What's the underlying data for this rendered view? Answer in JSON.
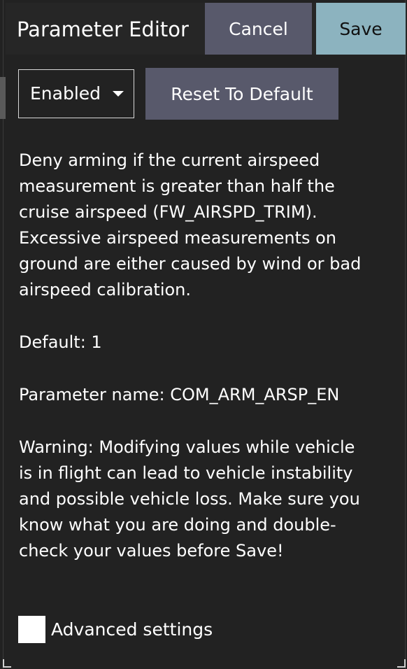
{
  "header": {
    "title": "Parameter Editor",
    "cancel_label": "Cancel",
    "save_label": "Save"
  },
  "controls": {
    "value_selected": "Enabled",
    "reset_label": "Reset To Default"
  },
  "content": {
    "description": "Deny arming if the current airspeed measurement is greater than half the cruise airspeed (FW_AIRSPD_TRIM). Excessive airspeed measurements on ground are either caused by wind or bad airspeed calibration.",
    "default_text": "Default: 1",
    "parameter_name_text": "Parameter name: COM_ARM_ARSP_EN",
    "warning": "Warning: Modifying values while vehicle is in flight can lead to vehicle instability and possible vehicle loss. Make sure you know what you are doing and double-check your values before Save!"
  },
  "advanced": {
    "label": "Advanced settings",
    "checked": false
  },
  "colors": {
    "background": "#222222",
    "button": "#58596b",
    "save_button": "#8cb3bf",
    "text": "#ffffff"
  }
}
